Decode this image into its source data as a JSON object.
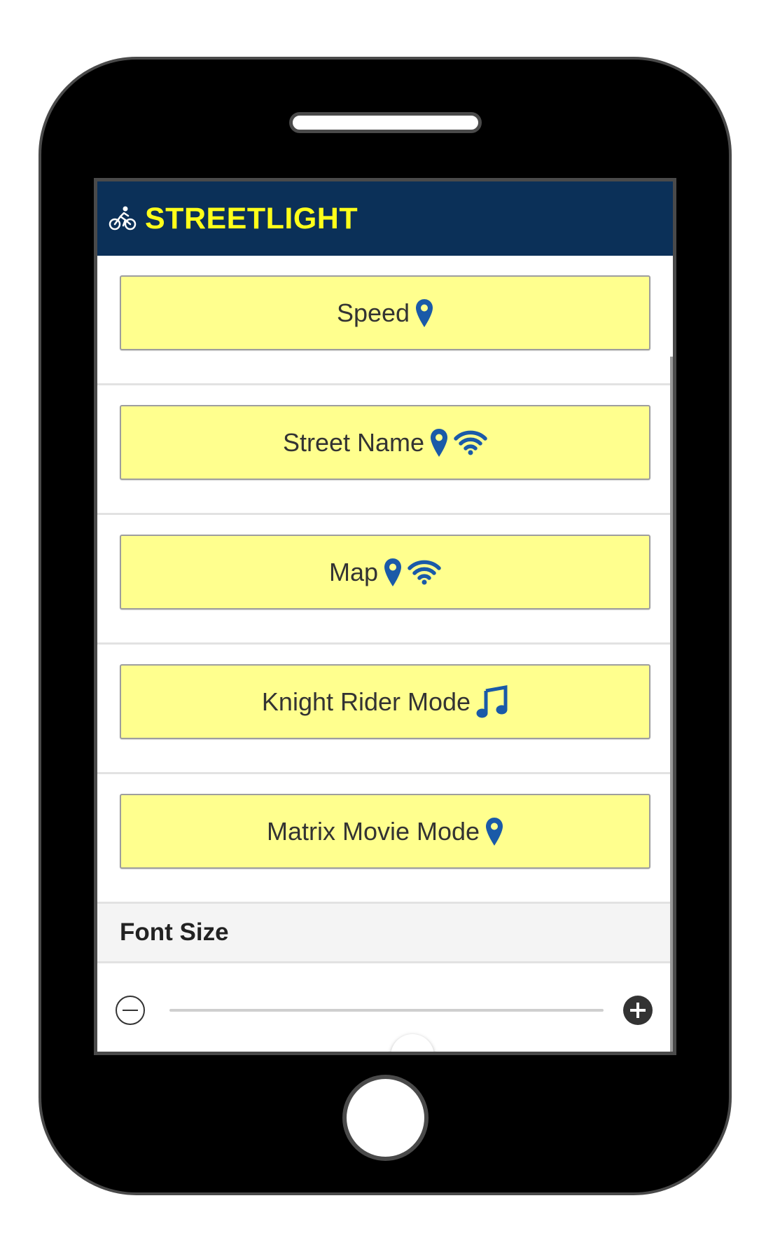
{
  "header": {
    "title": "STREETLIGHT",
    "icon": "bicycle-icon",
    "background_color": "#0b3058",
    "title_color": "#ffff1a"
  },
  "modes": [
    {
      "label": "Speed",
      "icons": [
        "location-pin-icon"
      ]
    },
    {
      "label": "Street Name",
      "icons": [
        "location-pin-icon",
        "wifi-icon"
      ]
    },
    {
      "label": "Map",
      "icons": [
        "location-pin-icon",
        "wifi-icon"
      ]
    },
    {
      "label": "Knight Rider Mode",
      "icons": [
        "music-note-icon"
      ]
    },
    {
      "label": "Matrix Movie Mode",
      "icons": [
        "location-pin-icon"
      ]
    }
  ],
  "button_color": "#ffff8e",
  "icon_color": "#1a5aa8",
  "font_size": {
    "title": "Font Size",
    "slider_value": 0.56,
    "decrease_icon": "minus-circle-icon",
    "increase_icon": "plus-circle-icon"
  }
}
